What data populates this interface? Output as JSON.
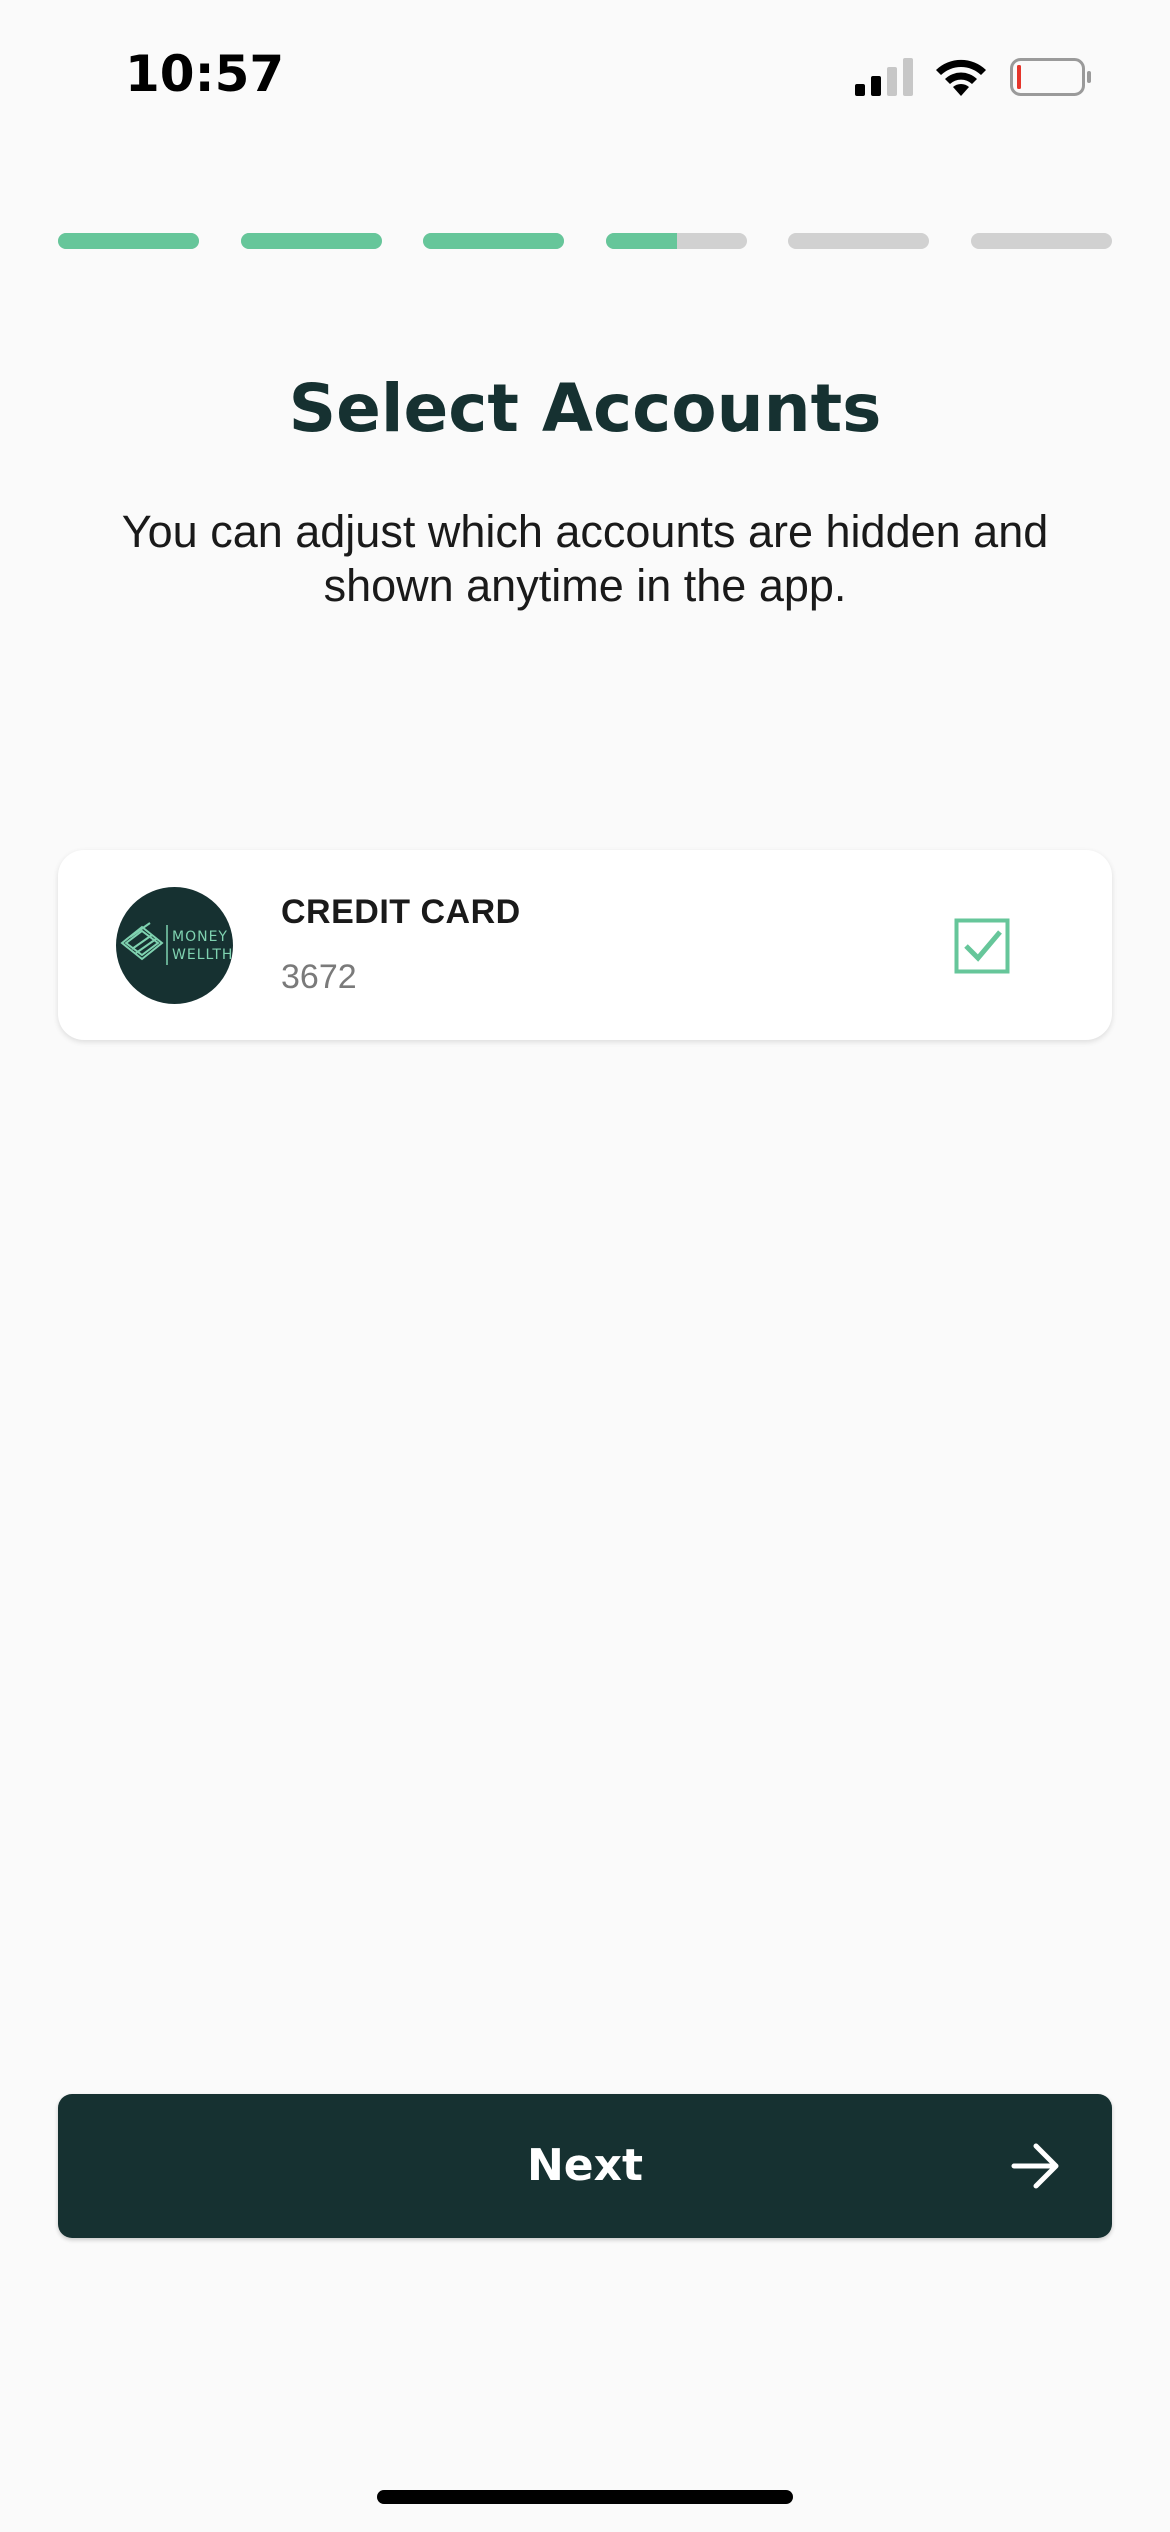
{
  "status_bar": {
    "time": "10:57",
    "icons": [
      "cellular-signal-icon",
      "wifi-icon",
      "battery-low-icon"
    ]
  },
  "progress": {
    "segments": [
      1,
      1,
      1,
      0.5,
      0,
      0
    ],
    "active_color": "#66c69a",
    "inactive_color": "#d1d1d1"
  },
  "header": {
    "title": "Select Accounts",
    "subtitle": "You can adjust which accounts are hidden and shown anytime in the app."
  },
  "accounts": [
    {
      "logo_text_line1": "MONEY",
      "logo_text_line2": "WELLTH",
      "name": "CREDIT CARD",
      "number": "3672",
      "selected": true
    }
  ],
  "footer": {
    "next_label": "Next"
  },
  "colors": {
    "brand_dark": "#163131",
    "accent_green": "#66c69a",
    "background": "#fafafa"
  }
}
